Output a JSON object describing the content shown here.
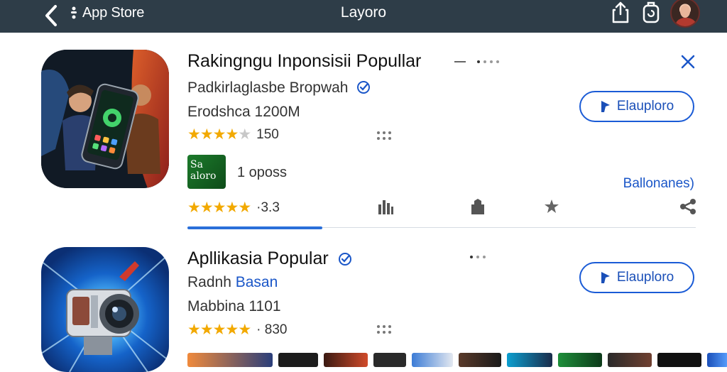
{
  "nav": {
    "back_label": "App Store",
    "title": "Layoro"
  },
  "apps": [
    {
      "title": "Rakingngu Inponsisii Popullar",
      "developer": "Padkirlaglasbe Bropwah",
      "downloads": "Erodshca 1200M",
      "rating_text": "150",
      "rating_value": 3.5,
      "button_label": "Elauploro",
      "dev_badge": "Sa aloro",
      "dev_count": "1 oposs",
      "more_link": "Ballonanes)",
      "rating2_text": "·3.3",
      "rating2_value": 4.5
    },
    {
      "title": "Apllikasia Popular",
      "developer_prefix": "Radnh",
      "developer_accent": "Basan",
      "downloads": "Mabbina 1101",
      "rating_text": "· 830",
      "rating_value": 4.5,
      "button_label": "Elauploro"
    }
  ],
  "icons": [
    "back-chevron-icon",
    "app-store-icon",
    "share-icon",
    "clipboard-icon",
    "close-icon",
    "verified-icon",
    "grid-dots-icon",
    "bar-chart-icon",
    "bag-icon",
    "star-icon",
    "share-nodes-icon",
    "pin-icon"
  ],
  "colors": {
    "topbar": "#2e3d48",
    "accent": "#1a5bd6",
    "star": "#f2a900",
    "dev_badge": "#1c7a2b"
  }
}
